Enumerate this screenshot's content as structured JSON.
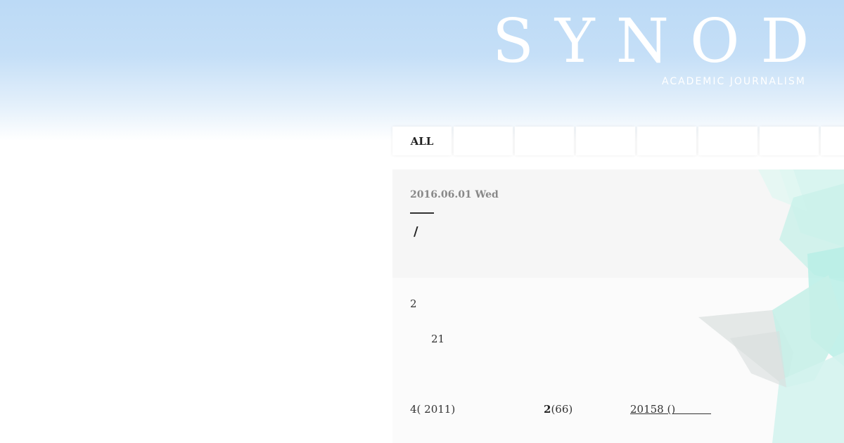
{
  "site": {
    "title": "SYNOD",
    "subtitle": "ACADEMIC JOURNALISM"
  },
  "tabs": [
    {
      "label": "ALL"
    },
    {
      "label": ""
    },
    {
      "label": ""
    },
    {
      "label": ""
    },
    {
      "label": ""
    },
    {
      "label": ""
    },
    {
      "label": ""
    },
    {
      "label": ""
    }
  ],
  "article": {
    "date": "2016.06.01 Wed",
    "title": "/",
    "paragraphs": {
      "line1": "2",
      "line2": "21",
      "line3a": "4( 2011)",
      "line3b_bold": "2",
      "line3b_rest": "(66)",
      "line3c": "20158 ()"
    }
  },
  "colors": {
    "sky_top": "#bcdaf6",
    "tab_bg": "#ffffff",
    "article_bg": "#fbfbfb",
    "article_head_bg": "#f6f6f6",
    "deco_teal": "#bff2ea"
  }
}
